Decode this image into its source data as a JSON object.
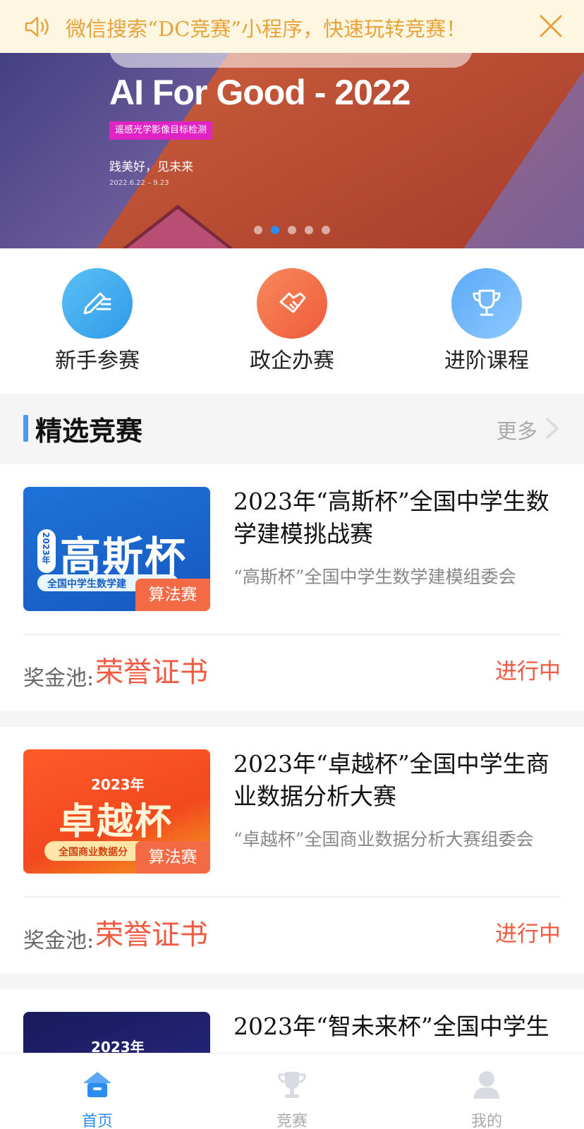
{
  "notice": {
    "text": "微信搜索“DC竞赛”小程序，快速玩转竞赛！"
  },
  "banner": {
    "title": "AI For Good - 2022",
    "tag": "遥感光学影像目标检测",
    "slogan": "践美好，见未来",
    "date": "2022.6.22 – 9.23",
    "dots_total": 5,
    "dots_active": 2
  },
  "quick_entries": [
    {
      "label": "新手参赛",
      "icon": "pencil-list-icon"
    },
    {
      "label": "政企办赛",
      "icon": "handshake-icon"
    },
    {
      "label": "进阶课程",
      "icon": "trophy-icon"
    }
  ],
  "section": {
    "title": "精选竞赛",
    "more": "更多"
  },
  "competitions": [
    {
      "title": "2023年“高斯杯”全国中学生数学建模挑战赛",
      "org": "“高斯杯”全国中学生数学建模组委会",
      "image_year": "2023年",
      "image_name": "高斯杯",
      "image_sub": "全国中学生数学建",
      "category": "算法赛",
      "prize_label": "奖金池:",
      "prize_value": "荣誉证书",
      "status": "进行中"
    },
    {
      "title": "2023年“卓越杯”全国中学生商业数据分析大赛",
      "org": "“卓越杯”全国商业数据分析大赛组委会",
      "image_year": "2023年",
      "image_name": "卓越杯",
      "image_sub": "全国商业数据分",
      "category": "算法赛",
      "prize_label": "奖金池:",
      "prize_value": "荣誉证书",
      "status": "进行中"
    },
    {
      "title": "2023年“智未来杯”全国中学生",
      "image_year": "2023年"
    }
  ],
  "tabbar": [
    {
      "label": "首页",
      "icon": "home-icon",
      "active": true
    },
    {
      "label": "竞赛",
      "icon": "trophy-icon",
      "active": false
    },
    {
      "label": "我的",
      "icon": "user-icon",
      "active": false
    }
  ],
  "colors": {
    "accent": "#2c8cf0",
    "highlight": "#f05a40",
    "notice_text": "#e8a33c"
  }
}
